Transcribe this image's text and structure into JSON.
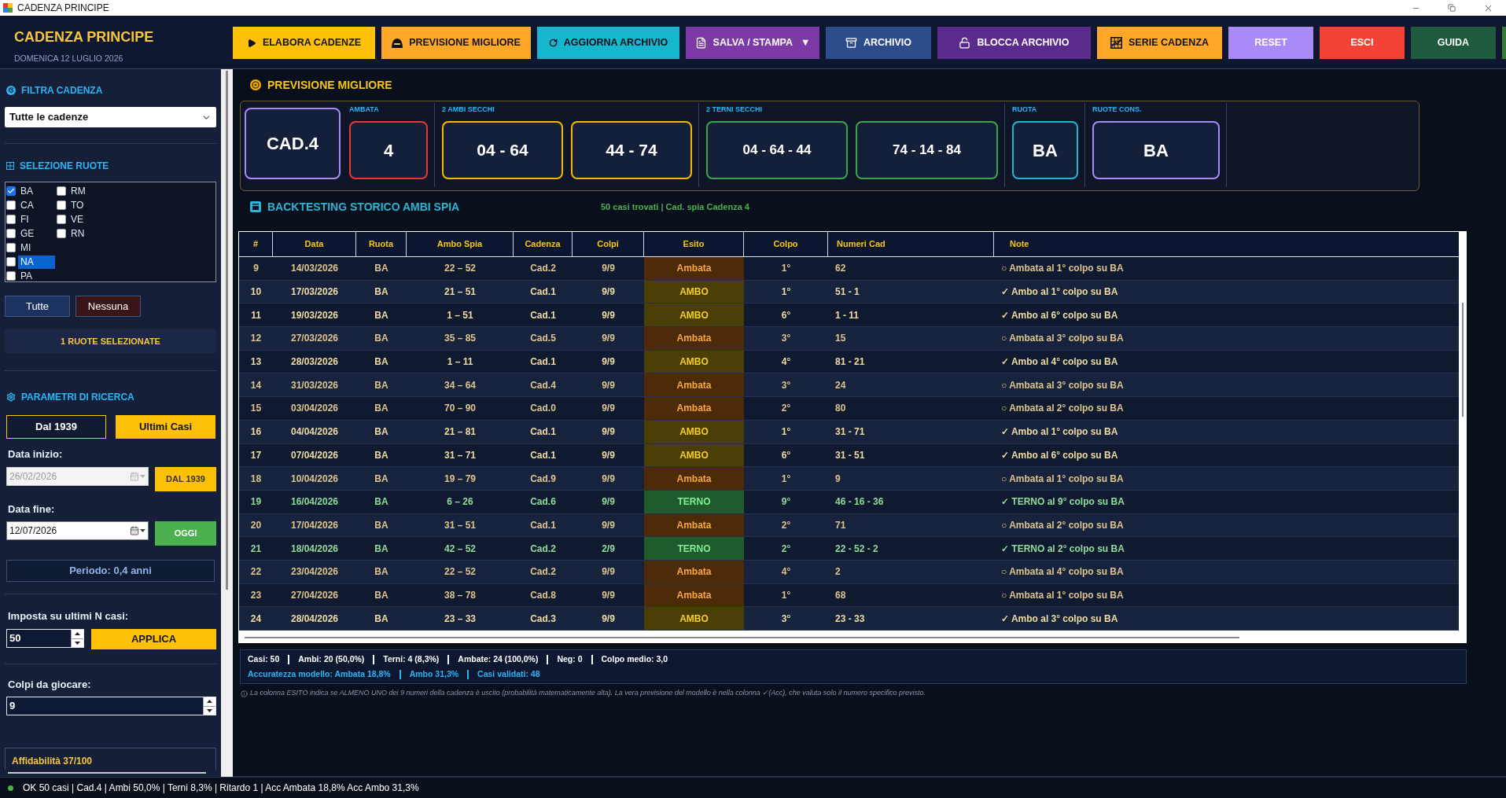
{
  "window": {
    "title": "CADENZA PRINCIPE"
  },
  "header": {
    "title": "CADENZA PRINCIPE",
    "date": "DOMENICA 12 LUGLIO 2026"
  },
  "toolbar": [
    {
      "label": "ELABORA CADENZE",
      "color": "#ffc107",
      "dark_text": true
    },
    {
      "label": "PREVISIONE MIGLIORE",
      "color": "#ffa726",
      "dark_text": true
    },
    {
      "label": "AGGIORNA ARCHIVIO",
      "color": "#17b6cf",
      "dark_text": true
    },
    {
      "label": "SALVA / STAMPA",
      "caret": "▼",
      "color": "#7b3aa6",
      "dark_text": false
    },
    {
      "label": "ARCHIVIO",
      "color": "#2c4c8c",
      "dark_text": false
    },
    {
      "label": "BLOCCA ARCHIVIO",
      "color": "#5b2b8c",
      "dark_text": false
    },
    {
      "label": "SERIE CADENZA",
      "color": "#ffa726",
      "dark_text": true
    },
    {
      "label": "RESET",
      "color": "#a98bf7",
      "dark_text": false
    },
    {
      "label": "ESCI",
      "color": "#f44336",
      "dark_text": false
    },
    {
      "label": "GUIDA",
      "color": "#1e5a3c",
      "dark_text": false
    },
    {
      "color": "#2e7d32"
    }
  ],
  "sidebar": {
    "filter": {
      "title": "FILTRA CADENZA",
      "value": "Tutte le cadenze"
    },
    "wheels": {
      "title": "SELEZIONE RUOTE",
      "items": [
        {
          "label": "BA",
          "checked": true,
          "selected": false
        },
        {
          "label": "CA",
          "checked": false,
          "selected": false
        },
        {
          "label": "FI",
          "checked": false,
          "selected": false
        },
        {
          "label": "GE",
          "checked": false,
          "selected": false
        },
        {
          "label": "MI",
          "checked": false,
          "selected": false
        },
        {
          "label": "NA",
          "checked": false,
          "selected": true
        },
        {
          "label": "PA",
          "checked": false,
          "selected": false
        },
        {
          "label": "RM",
          "checked": false,
          "selected": false
        },
        {
          "label": "TO",
          "checked": false,
          "selected": false
        },
        {
          "label": "VE",
          "checked": false,
          "selected": false
        },
        {
          "label": "RN",
          "checked": false,
          "selected": false
        }
      ]
    },
    "wheel_buttons": [
      {
        "label": "Tutte",
        "color": "#1c3260"
      },
      {
        "label": "Nessuna",
        "color": "#3a1517"
      }
    ],
    "selected_count": "1 RUOTE SELEZIONATE",
    "params": {
      "title": "PARAMETRI DI RICERCA",
      "modes": [
        {
          "label": "Dal 1939",
          "selected": false
        },
        {
          "label": "Ultimi Casi",
          "selected": true
        }
      ],
      "dates": [
        {
          "label": "Data inizio:",
          "value": "26/02/2026",
          "disabled": true,
          "button": {
            "label": "DAL 1939",
            "color": "#ffc107",
            "dark_text": true
          }
        },
        {
          "label": "Data fine:",
          "value": "12/07/2026",
          "disabled": false,
          "button": {
            "label": "OGGI",
            "color": "#4caf50",
            "dark_text": false
          }
        }
      ],
      "period": "Periodo: 0,4 anni"
    },
    "last_cases": {
      "label": "Imposta su ultimi N casi:",
      "value": "50",
      "button": "APPLICA"
    },
    "shots": {
      "label": "Colpi da giocare:",
      "value": "9"
    },
    "reliability": "Affidabilità 37/100"
  },
  "prediction": {
    "title": "PREVISIONE MIGLIORE",
    "cadence": "CAD.4",
    "groups": [
      {
        "label": "AMBATA",
        "color": "#e53935",
        "values": [
          "4"
        ]
      },
      {
        "label": "2 AMBI SECCHI",
        "color": "#f5b800",
        "values": [
          "04 - 64",
          "44 - 74"
        ]
      },
      {
        "label": "2 TERNI SECCHI",
        "color": "#3fa34d",
        "values": [
          "04 - 64 - 44",
          "74 - 14 - 84"
        ]
      },
      {
        "label": "RUOTA",
        "color": "#1fb6d4",
        "values": [
          "BA"
        ]
      },
      {
        "label": "RUOTE CONS.",
        "color": "#a78bfa",
        "values": [
          "BA"
        ]
      }
    ]
  },
  "backtest": {
    "title": "BACKTESTING STORICO AMBI SPIA",
    "summary": "50 casi trovati | Cad. spia Cadenza 4",
    "columns": [
      "#",
      "Data",
      "Ruota",
      "Ambo Spia",
      "Cadenza",
      "Colpi",
      "Esito",
      "Colpo",
      "Numeri Cad",
      "Note"
    ],
    "rows": [
      {
        "kind": "ambata",
        "cells": [
          "9",
          "14/03/2026",
          "BA",
          "22 – 52",
          "Cad.2",
          "9/9",
          "Ambata",
          "1°",
          "62",
          "○ Ambata al 1° colpo su BA"
        ]
      },
      {
        "kind": "ambo",
        "cells": [
          "10",
          "17/03/2026",
          "BA",
          "21 – 51",
          "Cad.1",
          "9/9",
          "AMBO",
          "1°",
          "51 - 1",
          "✓ Ambo al 1° colpo su BA"
        ]
      },
      {
        "kind": "ambo",
        "cells": [
          "11",
          "19/03/2026",
          "BA",
          "1 – 51",
          "Cad.1",
          "9/9",
          "AMBO",
          "6°",
          "1 - 11",
          "✓ Ambo al 6° colpo su BA"
        ]
      },
      {
        "kind": "ambata",
        "cells": [
          "12",
          "27/03/2026",
          "BA",
          "35 – 85",
          "Cad.5",
          "9/9",
          "Ambata",
          "3°",
          "15",
          "○ Ambata al 3° colpo su BA"
        ]
      },
      {
        "kind": "ambo",
        "cells": [
          "13",
          "28/03/2026",
          "BA",
          "1 – 11",
          "Cad.1",
          "9/9",
          "AMBO",
          "4°",
          "81 - 21",
          "✓ Ambo al 4° colpo su BA"
        ]
      },
      {
        "kind": "ambata",
        "cells": [
          "14",
          "31/03/2026",
          "BA",
          "34 – 64",
          "Cad.4",
          "9/9",
          "Ambata",
          "3°",
          "24",
          "○ Ambata al 3° colpo su BA"
        ]
      },
      {
        "kind": "ambata",
        "cells": [
          "15",
          "03/04/2026",
          "BA",
          "70 – 90",
          "Cad.0",
          "9/9",
          "Ambata",
          "2°",
          "80",
          "○ Ambata al 2° colpo su BA"
        ]
      },
      {
        "kind": "ambo",
        "cells": [
          "16",
          "04/04/2026",
          "BA",
          "21 – 81",
          "Cad.1",
          "9/9",
          "AMBO",
          "1°",
          "31 - 71",
          "✓ Ambo al 1° colpo su BA"
        ]
      },
      {
        "kind": "ambo",
        "cells": [
          "17",
          "07/04/2026",
          "BA",
          "31 – 71",
          "Cad.1",
          "9/9",
          "AMBO",
          "6°",
          "31 - 51",
          "✓ Ambo al 6° colpo su BA"
        ]
      },
      {
        "kind": "ambata",
        "cells": [
          "18",
          "10/04/2026",
          "BA",
          "19 – 79",
          "Cad.9",
          "9/9",
          "Ambata",
          "1°",
          "9",
          "○ Ambata al 1° colpo su BA"
        ]
      },
      {
        "kind": "terno",
        "cells": [
          "19",
          "16/04/2026",
          "BA",
          "6 – 26",
          "Cad.6",
          "9/9",
          "TERNO",
          "9°",
          "46 - 16 - 36",
          "✓ TERNO al 9° colpo su BA"
        ]
      },
      {
        "kind": "ambata",
        "cells": [
          "20",
          "17/04/2026",
          "BA",
          "31 – 51",
          "Cad.1",
          "9/9",
          "Ambata",
          "2°",
          "71",
          "○ Ambata al 2° colpo su BA"
        ]
      },
      {
        "kind": "terno",
        "cells": [
          "21",
          "18/04/2026",
          "BA",
          "42 – 52",
          "Cad.2",
          "2/9",
          "TERNO",
          "2°",
          "22 - 52 - 2",
          "✓ TERNO al 2° colpo su BA"
        ]
      },
      {
        "kind": "ambata",
        "cells": [
          "22",
          "23/04/2026",
          "BA",
          "22 – 52",
          "Cad.2",
          "9/9",
          "Ambata",
          "4°",
          "2",
          "○ Ambata al 4° colpo su BA"
        ]
      },
      {
        "kind": "ambata",
        "cells": [
          "23",
          "27/04/2026",
          "BA",
          "38 – 78",
          "Cad.8",
          "9/9",
          "Ambata",
          "1°",
          "68",
          "○ Ambata al 1° colpo su BA"
        ]
      },
      {
        "kind": "ambo",
        "cells": [
          "24",
          "28/04/2026",
          "BA",
          "23 – 33",
          "Cad.3",
          "9/9",
          "AMBO",
          "3°",
          "23 - 33",
          "✓ Ambo al 3° colpo su BA"
        ]
      }
    ]
  },
  "stats": {
    "totals": [
      "Casi: 50",
      "Ambi: 20 (50,0%)",
      "Terni: 4 (8,3%)",
      "Ambate: 24 (100,0%)",
      "Neg: 0",
      "Colpo medio: 3,0"
    ],
    "accuracy": [
      "Accuratezza modello: Ambata 18,8%",
      "Ambo 31,3%",
      "Casi validati: 48"
    ]
  },
  "footnote": "La colonna ESITO indica se ALMENO UNO dei 9 numeri della cadenza è uscito (probabilità matematicamente alta). La vera previsione del modello è nella colonna ✓(Acc), che valuta solo il numero specifico previsto.",
  "status_bar": {
    "text": "OK 50 casi | Cad.4 | Ambi 50,0% | Terni 8,3% | Ritardo 1 | Acc Ambata 18,8% Acc Ambo 31,3%"
  }
}
